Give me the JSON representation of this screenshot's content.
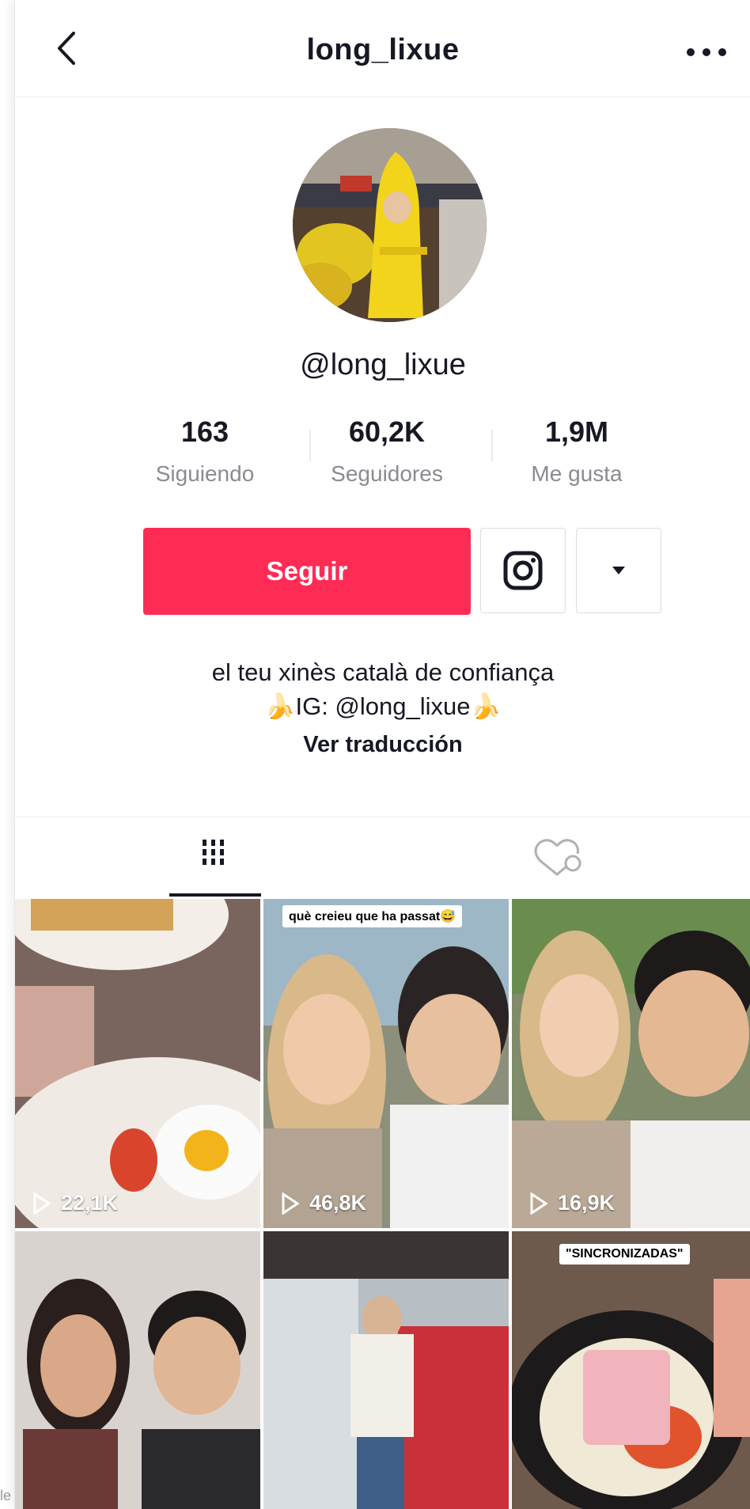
{
  "corner_text": "le",
  "header": {
    "title": "long_lixue",
    "back_icon": "chevron-left-icon",
    "more_icon": "ellipsis-icon"
  },
  "profile": {
    "handle": "@long_lixue",
    "stats": [
      {
        "value": "163",
        "label": "Siguiendo"
      },
      {
        "value": "60,2K",
        "label": "Seguidores"
      },
      {
        "value": "1,9M",
        "label": "Me gusta"
      }
    ],
    "follow_label": "Seguir",
    "bio_line1": "el teu xinès català de confiança",
    "bio_line2": "IG: @long_lixue",
    "translate_label": "Ver traducción",
    "accent_color": "#fe2c55"
  },
  "tabs": [
    {
      "name": "videos",
      "icon": "grid-icon",
      "active": true
    },
    {
      "name": "liked",
      "icon": "heart-lock-icon",
      "active": false
    }
  ],
  "videos": [
    {
      "views": "22,1K",
      "caption": ""
    },
    {
      "views": "46,8K",
      "caption": "què creieu que ha passat😅"
    },
    {
      "views": "16,9K",
      "caption": ""
    },
    {
      "views": "",
      "caption": ""
    },
    {
      "views": "",
      "caption": ""
    },
    {
      "views": "",
      "caption": "\"SINCRONIZADAS\""
    }
  ]
}
